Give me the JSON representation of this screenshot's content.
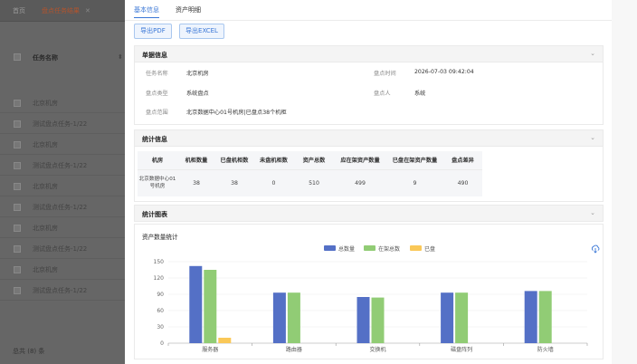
{
  "background": {
    "tabs": [
      {
        "label": "首页"
      },
      {
        "label": "盘点任务结果",
        "close": "✕"
      }
    ],
    "header_label": "任务名称",
    "sort_glyph": "⬍",
    "rows": [
      {
        "label": "北京机房"
      },
      {
        "label": "测试盘点任务-1/22"
      },
      {
        "label": "北京机房"
      },
      {
        "label": "测试盘点任务-1/22"
      },
      {
        "label": "北京机房"
      },
      {
        "label": "测试盘点任务-1/22"
      },
      {
        "label": "北京机房"
      },
      {
        "label": "测试盘点任务-1/22"
      },
      {
        "label": "北京机房"
      },
      {
        "label": "测试盘点任务-1/22"
      }
    ],
    "footer": "总共 (8) 条"
  },
  "drawer": {
    "tabs": [
      {
        "label": "基本信息",
        "active": true
      },
      {
        "label": "资产明细",
        "active": false
      }
    ],
    "buttons": [
      {
        "label": "导出PDF"
      },
      {
        "label": "导出EXCEL"
      }
    ],
    "sections": {
      "basic": {
        "title": "单据信息",
        "task_name_label": "任务名称",
        "task_name": "北京机房",
        "time_label": "盘点时间",
        "time": "2026-07-03 09:42:04",
        "type_label": "盘点类型",
        "type": "系统盘点",
        "person_label": "盘点人",
        "person": "系统",
        "scope_label": "盘点范围",
        "scope": "北京数据中心01号机房|已盘点38个机柜"
      },
      "stats": {
        "title": "统计信息",
        "columns": [
          "机房",
          "机柜数量",
          "已盘机柜数",
          "未盘机柜数",
          "资产总数",
          "应在架资产数量",
          "已盘在架资产数量",
          "盘点差异"
        ],
        "row": [
          "北京数据中心01号机房",
          "38",
          "38",
          "0",
          "510",
          "499",
          "9",
          "490"
        ]
      },
      "charts": {
        "title": "统计图表"
      }
    }
  },
  "chart_data": {
    "type": "bar",
    "title": "资产数量统计",
    "categories": [
      "服务器",
      "路由器",
      "交换机",
      "磁盘阵列",
      "防火墙"
    ],
    "series": [
      {
        "name": "总数量",
        "color": "#5470c6",
        "values": [
          142,
          93,
          85,
          93,
          96
        ]
      },
      {
        "name": "在架总数",
        "color": "#91cc75",
        "values": [
          135,
          93,
          84,
          93,
          96
        ]
      },
      {
        "name": "已盘",
        "color": "#fac858",
        "values": [
          10,
          0,
          0,
          0,
          0
        ]
      }
    ],
    "ylim": [
      0,
      150
    ],
    "yticks": [
      "0",
      "30",
      "60",
      "90",
      "120",
      "150"
    ],
    "grid": true,
    "legend": "top-center"
  },
  "icons": {
    "download": "download-icon",
    "chevron": "chevron-down-icon"
  }
}
